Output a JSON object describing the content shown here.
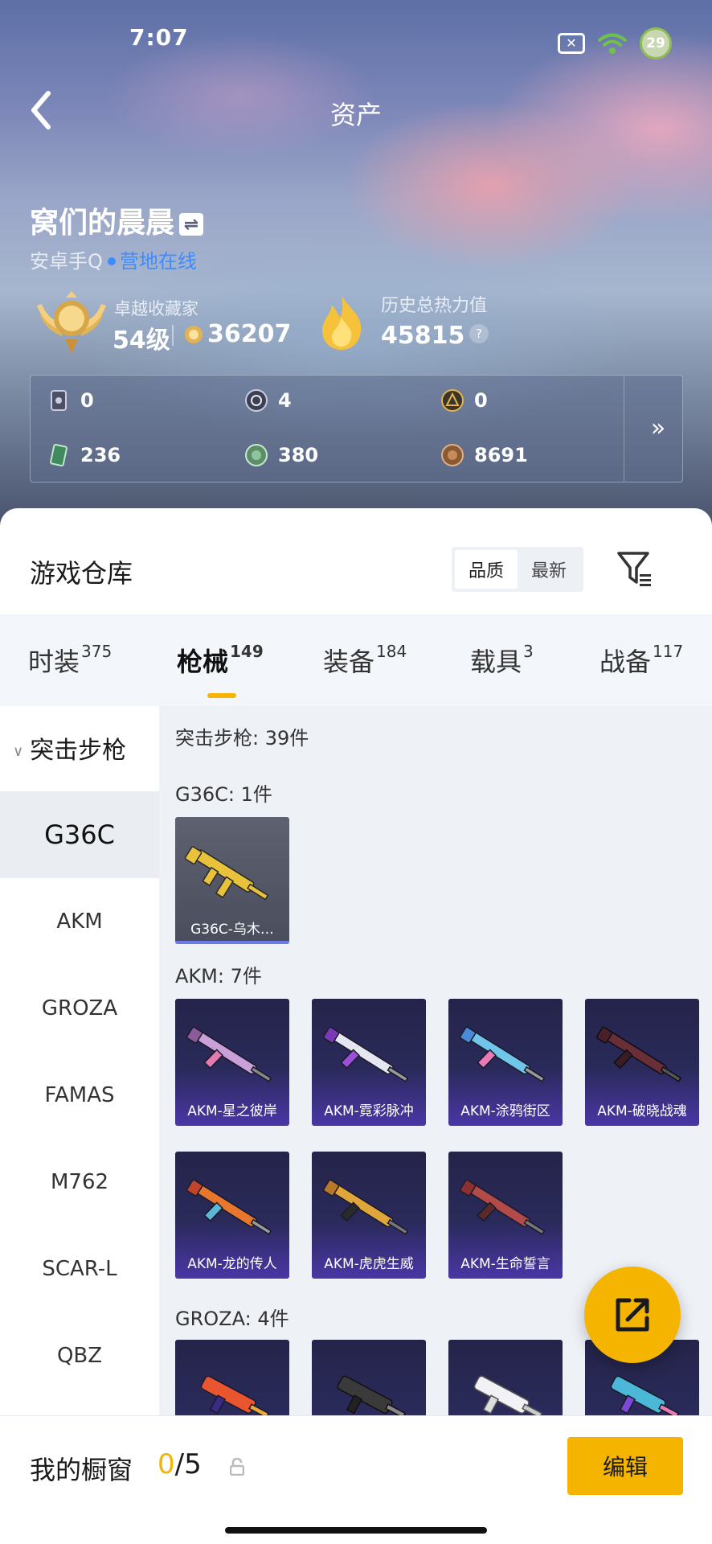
{
  "status_bar": {
    "time": "7:07",
    "battery": "29"
  },
  "header": {
    "title": "资产"
  },
  "user": {
    "name": "窝们的晨晨",
    "platform": "安卓手Q",
    "online": "营地在线"
  },
  "rank": {
    "label": "卓越收藏家",
    "level": "54级",
    "points": "36207"
  },
  "heat": {
    "label": "历史总热力值",
    "value": "45815",
    "help": "?"
  },
  "resources": [
    {
      "icon": "card-icon",
      "value": "0"
    },
    {
      "icon": "silver-coin-icon",
      "value": "4"
    },
    {
      "icon": "gold-badge-icon",
      "value": "0"
    },
    {
      "icon": "green-ticket-icon",
      "value": "236"
    },
    {
      "icon": "green-coin-icon",
      "value": "380"
    },
    {
      "icon": "bronze-coin-icon",
      "value": "8691"
    }
  ],
  "resources_more": "»",
  "warehouse": {
    "title": "游戏仓库",
    "sort_options": [
      "品质",
      "最新"
    ],
    "active_sort": "品质"
  },
  "categories": [
    {
      "label": "时装",
      "count": "375"
    },
    {
      "label": "枪械",
      "count": "149"
    },
    {
      "label": "装备",
      "count": "184"
    },
    {
      "label": "载具",
      "count": "3"
    },
    {
      "label": "战备",
      "count": "117"
    }
  ],
  "active_category": "枪械",
  "sidebar": {
    "group": "突击步枪",
    "items": [
      "G36C",
      "AKM",
      "GROZA",
      "FAMAS",
      "M762",
      "SCAR-L",
      "QBZ"
    ],
    "active": "G36C"
  },
  "content": {
    "summary": "突击步枪: 39件",
    "groups": [
      {
        "title": "G36C: 1件",
        "items": [
          "G36C-乌木…"
        ]
      },
      {
        "title": "AKM: 7件",
        "items": [
          "AKM-星之彼岸",
          "AKM-霓彩脉冲",
          "AKM-涂鸦街区",
          "AKM-破晓战魂",
          "AKM-龙的传人",
          "AKM-虎虎生威",
          "AKM-生命誓言"
        ]
      },
      {
        "title": "GROZA: 4件",
        "items": [
          "",
          "",
          "",
          ""
        ]
      }
    ]
  },
  "showcase": {
    "label": "我的橱窗",
    "current": "0",
    "total": "/5",
    "edit_label": "编辑"
  },
  "colors": {
    "accent": "#f5b400",
    "online": "#3d8cff",
    "card_purple": "#4a36a6",
    "card_gray": "#5d6170"
  }
}
